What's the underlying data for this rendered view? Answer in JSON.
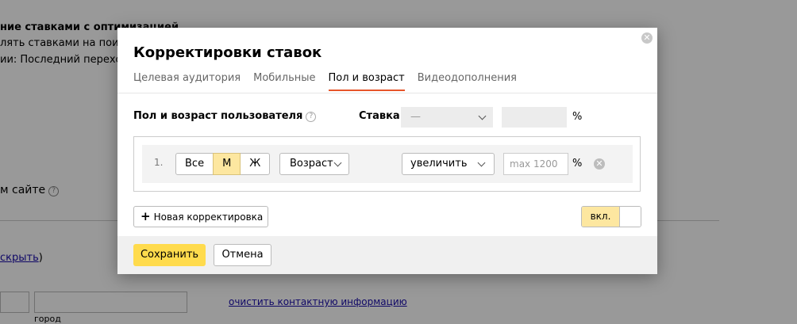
{
  "background": {
    "title": "ние ставками с оптимизацией",
    "line2": "лять ставками на поиске",
    "line3": "ии: Последний переход",
    "site_label": "м сайте",
    "hide_prefix": "",
    "hide_link": "скрыть",
    "hide_suffix": ")",
    "clear_contact_link": "очистить контактную информацию",
    "city_label": "город"
  },
  "modal": {
    "title": "Корректировки ставок",
    "tabs": [
      {
        "label": "Целевая аудитория",
        "active": false
      },
      {
        "label": "Мобильные",
        "active": false
      },
      {
        "label": "Пол и возраст",
        "active": true
      },
      {
        "label": "Видеодополнения",
        "active": false
      }
    ],
    "section_label": "Пол и возраст пользователя",
    "rate_label": "Ставка",
    "rate_select_value": "—",
    "percent_sign": "%",
    "adjustment": {
      "number": "1.",
      "gender_options": [
        {
          "label": "Все",
          "selected": false
        },
        {
          "label": "М",
          "selected": true
        },
        {
          "label": "Ж",
          "selected": false
        }
      ],
      "age_label": "Возраст",
      "direction": "увеличить",
      "value_placeholder": "max 1200"
    },
    "new_adjustment_label": "Новая корректировка",
    "toggle_label": "вкл.",
    "save_label": "Сохранить",
    "cancel_label": "Отмена"
  },
  "colors": {
    "accent_tab": "#e7552a",
    "primary_button": "#ffdb4d",
    "selected_segment": "#fde7a0"
  }
}
